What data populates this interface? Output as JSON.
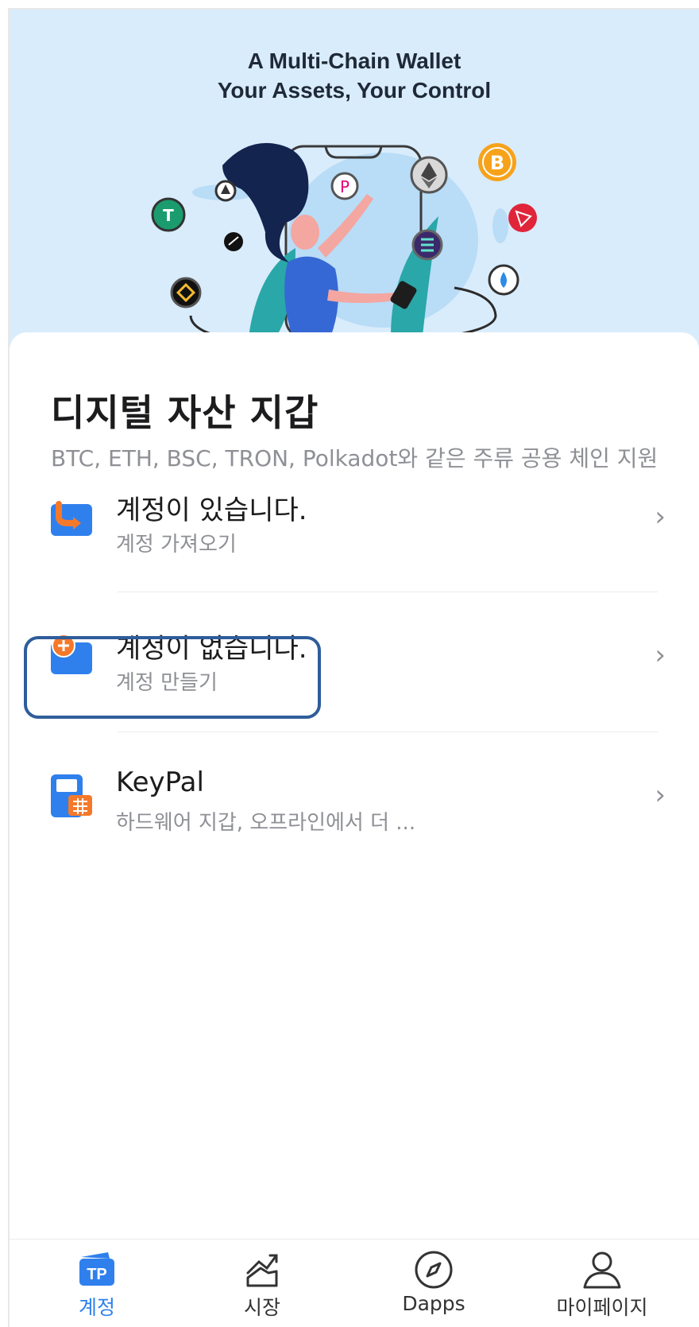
{
  "banner": {
    "title_line1": "A Multi-Chain Wallet",
    "title_line2": "Your Assets, Your Control"
  },
  "header": {
    "title": "디지털 자산 지갑",
    "subtitle": "BTC, ETH, BSC, TRON, Polkadot와 같은 주류 공용 체인 지원"
  },
  "options": [
    {
      "title": "계정이 있습니다.",
      "subtitle": "계정 가져오기",
      "icon": "import-wallet-icon"
    },
    {
      "title": "계정이 없습니다.",
      "subtitle": "계정 만들기",
      "icon": "create-wallet-icon"
    },
    {
      "title": "KeyPal",
      "subtitle": "하드웨어 지갑, 오프라인에서 더 ...",
      "icon": "hardware-wallet-icon"
    }
  ],
  "chevron": "›",
  "tabs": [
    {
      "label": "계정",
      "icon": "tp-wallet-icon",
      "active": true
    },
    {
      "label": "시장",
      "icon": "market-chart-icon",
      "active": false
    },
    {
      "label": "Dapps",
      "icon": "compass-icon",
      "active": false
    },
    {
      "label": "마이페이지",
      "icon": "profile-icon",
      "active": false
    }
  ],
  "colors": {
    "accent": "#2f80ed",
    "banner_bg": "#d9ecfb",
    "orange": "#f5792a",
    "highlight_border": "#2f5d9a"
  }
}
